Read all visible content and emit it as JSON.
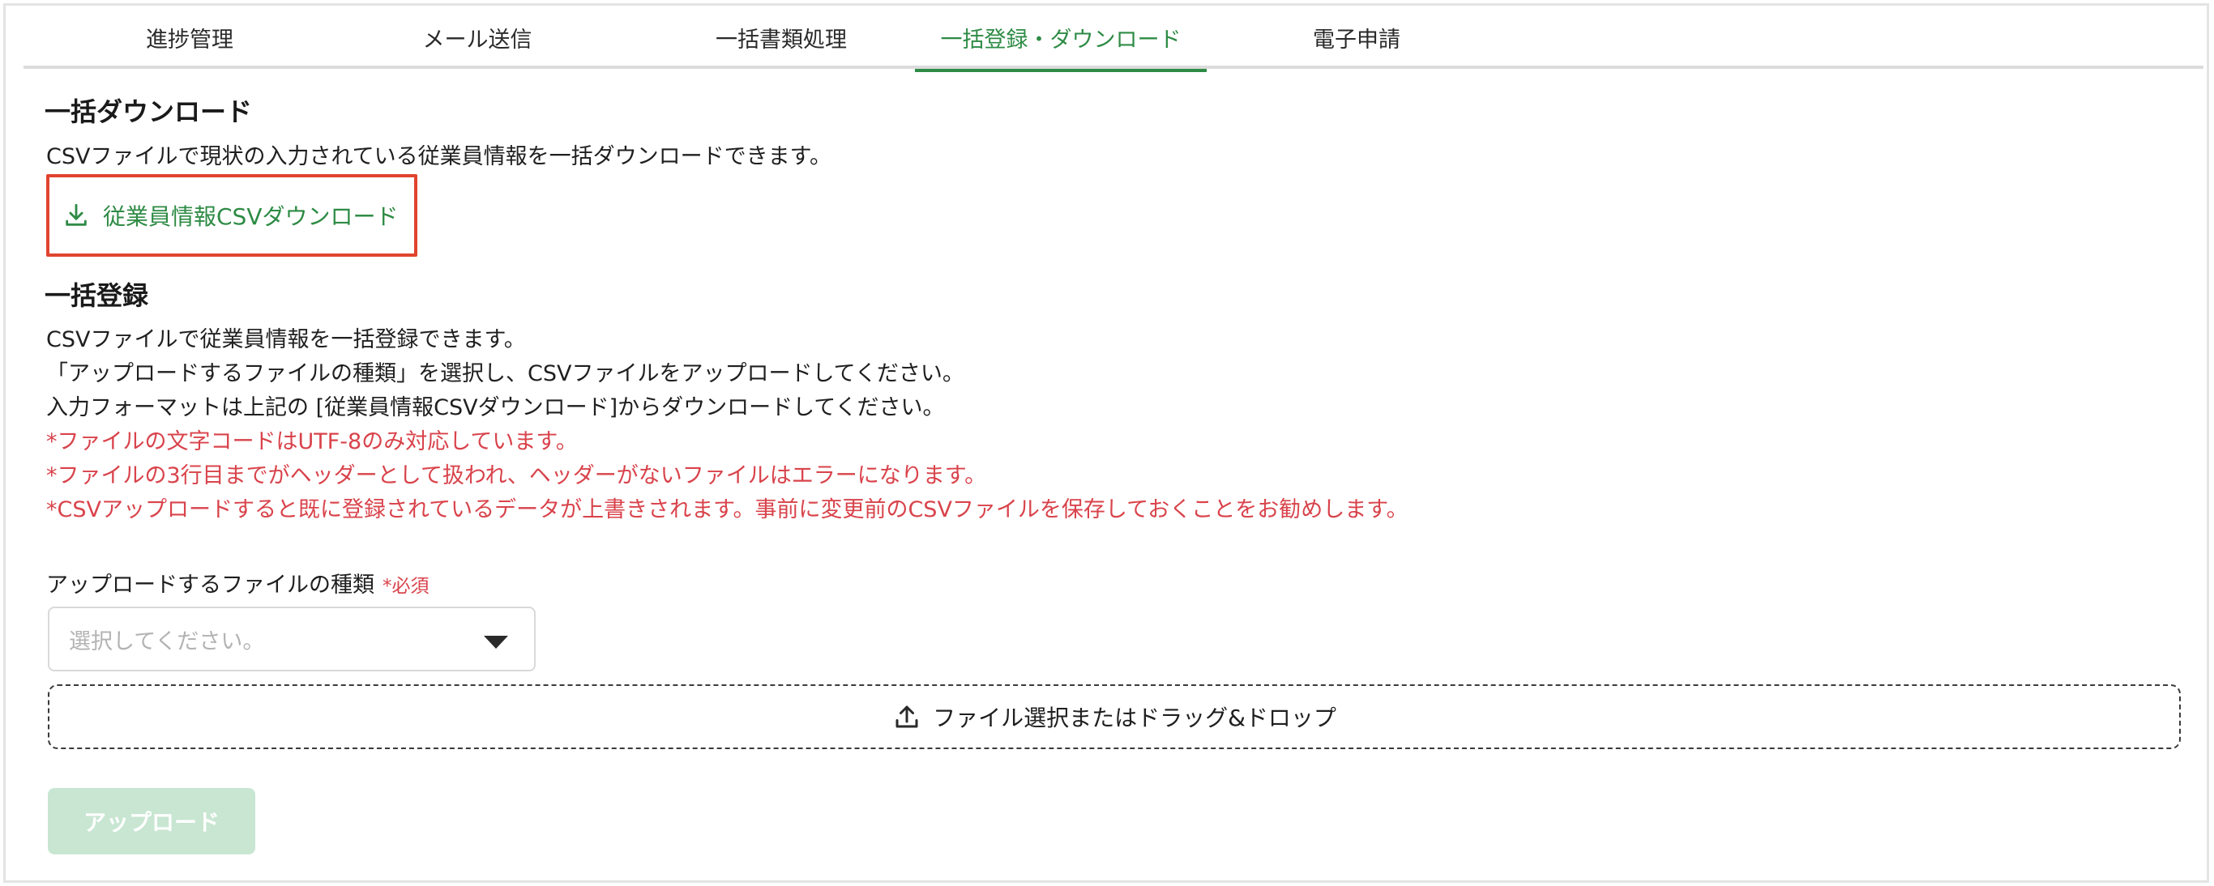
{
  "tabs": [
    {
      "label": "進捗管理"
    },
    {
      "label": "メール送信"
    },
    {
      "label": "一括書類処理"
    },
    {
      "label": "一括登録・ダウンロード",
      "active": true
    },
    {
      "label": "電子申請"
    }
  ],
  "download_section": {
    "heading": "一括ダウンロード",
    "description": "CSVファイルで現状の入力されている従業員情報を一括ダウンロードできます。",
    "download_link": "従業員情報CSVダウンロード",
    "icon": "download-icon"
  },
  "register_section": {
    "heading": "一括登録",
    "lines": [
      "CSVファイルで従業員情報を一括登録できます。",
      "「アップロードするファイルの種類」を選択し、CSVファイルをアップロードしてください。",
      "入力フォーマットは上記の [従業員情報CSVダウンロード]からダウンロードしてください。"
    ],
    "warnings": [
      "*ファイルの文字コードはUTF-8のみ対応しています。",
      "*ファイルの3行目までがヘッダーとして扱われ、ヘッダーがないファイルはエラーになります。",
      "*CSVアップロードすると既に登録されているデータが上書きされます。事前に変更前のCSVファイルを保存しておくことをお勧めします。"
    ]
  },
  "file_type_field": {
    "label": "アップロードするファイルの種類",
    "required": "*必須",
    "placeholder": "選択してください。"
  },
  "dropzone": {
    "label": "ファイル選択またはドラッグ&ドロップ",
    "icon": "upload-icon"
  },
  "upload_button": {
    "label": "アップロード",
    "disabled": true
  },
  "colors": {
    "accent": "#2e8b45",
    "warning": "#d9434b",
    "highlight_border": "#e0442e",
    "disabled_button": "#c8e6d2"
  }
}
